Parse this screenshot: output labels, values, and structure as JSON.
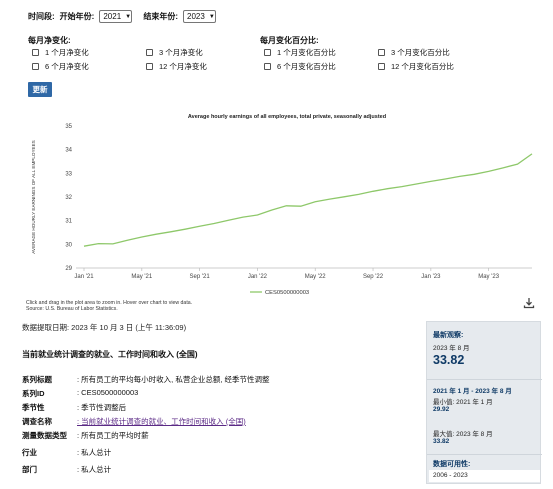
{
  "filters": {
    "time_label": "时间段:",
    "start_label": "开始年份:",
    "start_value": "2021",
    "end_label": "结束年份:",
    "end_value": "2023"
  },
  "monthly_change": {
    "title": "每月净变化:",
    "items": [
      "1 个月净变化",
      "3 个月净变化",
      "6 个月净变化",
      "12 个月净变化"
    ]
  },
  "monthly_pct": {
    "title": "每月变化百分比:",
    "items": [
      "1 个月变化百分比",
      "3 个月变化百分比",
      "6 个月变化百分比",
      "12 个月变化百分比"
    ]
  },
  "update_button": "更新",
  "chart_data": {
    "type": "line",
    "title": "Average hourly earnings of all employees, total private, seasonally adjusted",
    "ylabel": "AVERAGE HOURLY EARNINGS OF ALL EMPLOYEES",
    "xlabel": "",
    "ylim": [
      29,
      35
    ],
    "yticks": [
      29,
      30,
      31,
      32,
      33,
      34,
      35
    ],
    "xticks": [
      "Jan '21",
      "May '21",
      "Sep '21",
      "Jan '22",
      "May '22",
      "Sep '22",
      "Jan '23",
      "May '23"
    ],
    "series": [
      {
        "name": "CES0500000003",
        "color": "#8ec86a",
        "x": [
          "Jan 2021",
          "Feb 2021",
          "Mar 2021",
          "Apr 2021",
          "May 2021",
          "Jun 2021",
          "Jul 2021",
          "Aug 2021",
          "Sep 2021",
          "Oct 2021",
          "Nov 2021",
          "Dec 2021",
          "Jan 2022",
          "Feb 2022",
          "Mar 2022",
          "Apr 2022",
          "May 2022",
          "Jun 2022",
          "Jul 2022",
          "Aug 2022",
          "Sep 2022",
          "Oct 2022",
          "Nov 2022",
          "Dec 2022",
          "Jan 2023",
          "Feb 2023",
          "Mar 2023",
          "Apr 2023",
          "May 2023",
          "Jun 2023",
          "Jul 2023",
          "Aug 2023"
        ],
        "values": [
          29.92,
          30.03,
          30.02,
          30.17,
          30.31,
          30.43,
          30.53,
          30.64,
          30.76,
          30.88,
          31.02,
          31.15,
          31.24,
          31.45,
          31.63,
          31.61,
          31.8,
          31.91,
          32.01,
          32.11,
          32.24,
          32.35,
          32.44,
          32.55,
          32.66,
          32.76,
          32.87,
          32.96,
          33.08,
          33.23,
          33.39,
          33.82
        ]
      }
    ],
    "legend": "bottom",
    "grid": false,
    "notes": [
      "Click and drag in the plot area to zoom in. Hover over chart to view data.",
      "Source: U.S. Bureau of Labor Statistics."
    ]
  },
  "retrieval_text": "数据提取日期: 2023 年 10 月 3 日 (上午 11:36:09)",
  "survey_title": "当前就业统计调查的就业、工作时间和收入 (全国)",
  "meta": [
    {
      "label": "系列标题",
      "value": ": 所有员工的平均每小时收入, 私营企业总额, 经季节性调整"
    },
    {
      "label": "系列ID",
      "value": ": CES0500000003"
    },
    {
      "label": "季节性",
      "value": ": 季节性调整后"
    },
    {
      "label": "调查名称",
      "value": ": 当前就业统计调查的就业、工作时间和收入 (全国)",
      "link": true
    },
    {
      "label": "测量数据类型",
      "value": ": 所有员工的平均时薪"
    },
    {
      "label": "行业",
      "value": ": 私人总计"
    },
    {
      "label": "部门",
      "value": ": 私人总计"
    }
  ],
  "sidebar": {
    "latest_title": "最新观察:",
    "latest_date": "2023 年 8 月",
    "latest_value": "33.82",
    "range": "2021 年 1 月 - 2023 年 8 月",
    "min_text": "最小值: 2021 年 1 月",
    "min_value": "29.92",
    "max_text": "最大值: 2023 年 8 月",
    "max_value": "33.82",
    "availability_title": "数据可用性:",
    "availability_value": "2006 - 2023"
  }
}
